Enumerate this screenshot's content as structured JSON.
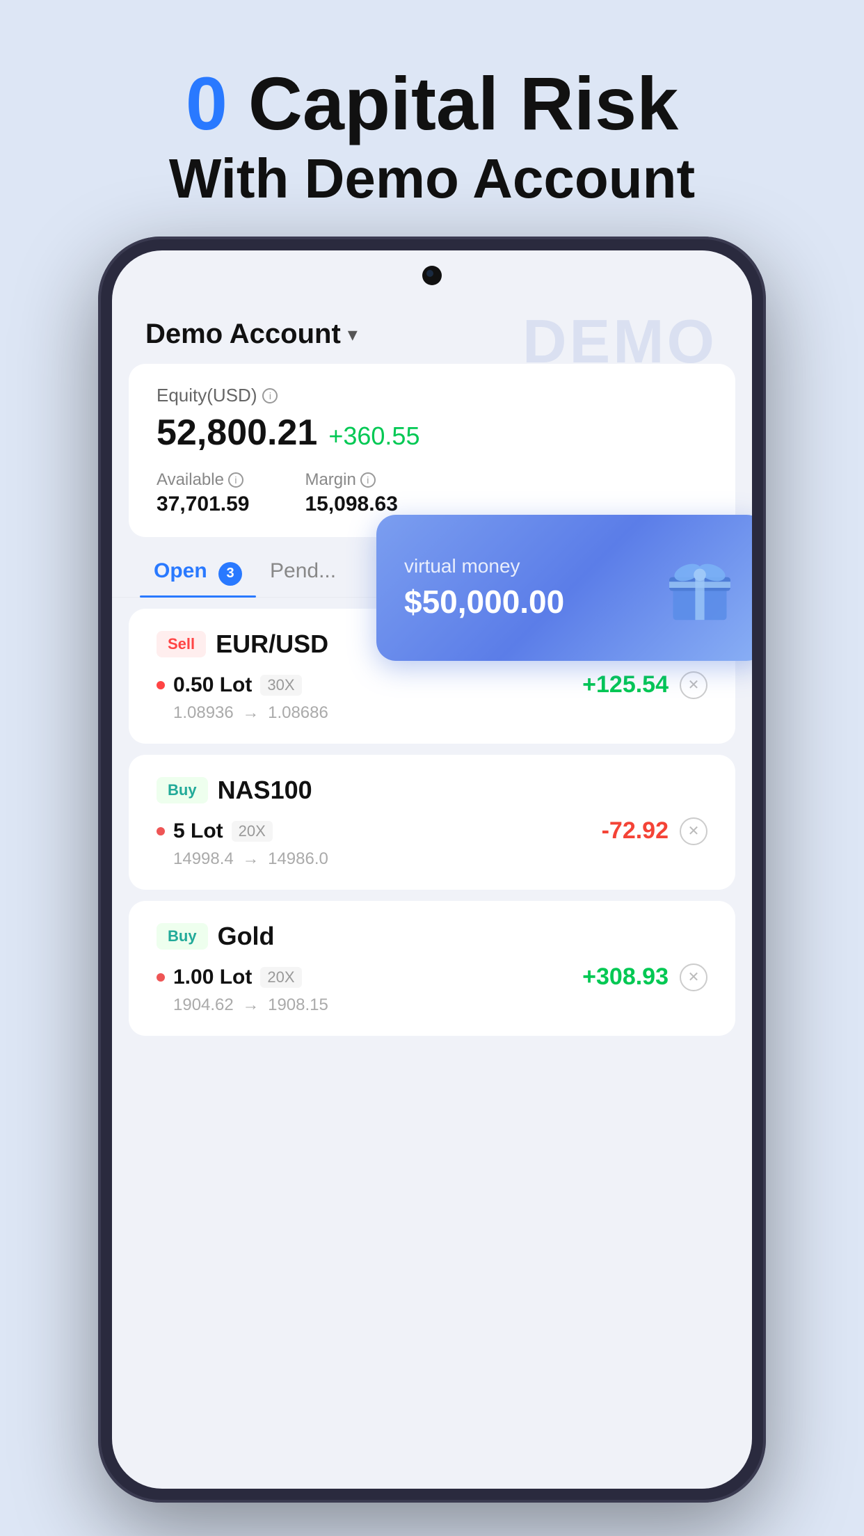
{
  "hero": {
    "zero_label": "0",
    "title_line1": " Capital Risk",
    "title_line2": "With Demo Account"
  },
  "phone": {
    "demo_account": "Demo Account",
    "demo_watermark": "DEMO",
    "equity_label": "Equity(USD)",
    "equity_value": "52,800.21",
    "equity_change": "+360.55",
    "available_label": "Available",
    "available_value": "37,701.59",
    "margin_label": "Margin",
    "margin_value": "15,098.63",
    "virtual_card": {
      "label": "virtual money",
      "amount": "$50,000.00"
    },
    "tabs": [
      {
        "label": "Open",
        "badge": "3",
        "active": true
      },
      {
        "label": "Pend...",
        "badge": null,
        "active": false
      }
    ],
    "trades": [
      {
        "type": "Sell",
        "symbol": "EUR/USD",
        "lot": "0.50 Lot",
        "leverage": "30X",
        "pnl": "+125.54",
        "pnl_positive": true,
        "price_from": "1.08936",
        "price_to": "1.08686"
      },
      {
        "type": "Buy",
        "symbol": "NAS100",
        "lot": "5 Lot",
        "leverage": "20X",
        "pnl": "-72.92",
        "pnl_positive": false,
        "price_from": "14998.4",
        "price_to": "14986.0"
      },
      {
        "type": "Buy",
        "symbol": "Gold",
        "lot": "1.00 Lot",
        "leverage": "20X",
        "pnl": "+308.93",
        "pnl_positive": true,
        "price_from": "1904.62",
        "price_to": "1908.15"
      }
    ]
  }
}
